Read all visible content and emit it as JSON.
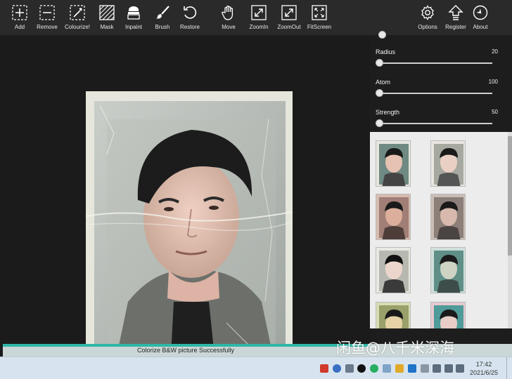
{
  "toolbar": {
    "left_tools": [
      {
        "label": "Add",
        "icon": "add-icon"
      },
      {
        "label": "Remove",
        "icon": "remove-icon"
      },
      {
        "label": "Colourize!",
        "icon": "colourize-icon"
      },
      {
        "label": "Mask",
        "icon": "mask-icon"
      },
      {
        "label": "Inpaint",
        "icon": "inpaint-icon"
      },
      {
        "label": "Brush",
        "icon": "brush-icon"
      },
      {
        "label": "Restore",
        "icon": "restore-icon"
      },
      {
        "label": "Move",
        "icon": "hand-icon"
      },
      {
        "label": "ZoomIn",
        "icon": "zoom-in-icon"
      },
      {
        "label": "ZoomOut",
        "icon": "zoom-out-icon"
      },
      {
        "label": "FitScreen",
        "icon": "fit-screen-icon"
      }
    ],
    "right_tools": [
      {
        "label": "Options",
        "icon": "gear-icon"
      },
      {
        "label": "Register",
        "icon": "register-arrow-icon"
      },
      {
        "label": "About",
        "icon": "compass-icon"
      }
    ]
  },
  "sliders": [
    {
      "label": "Radius",
      "value": "20"
    },
    {
      "label": "Atom",
      "value": "100"
    },
    {
      "label": "Strength",
      "value": "50"
    }
  ],
  "status": {
    "message": "Colorize B&W picture Successfully",
    "progress_fraction": 1.0
  },
  "taskbar": {
    "time": "17:42",
    "date": "2021/6/25"
  },
  "watermark": "闲鱼@八千米深海",
  "colors": {
    "toolbar_bg": "#2a2a2a",
    "canvas_bg": "#1b1b1b",
    "panel_bg": "#1d1d1d",
    "thumbs_bg": "#ececec",
    "progress": "#2fb6a6"
  }
}
